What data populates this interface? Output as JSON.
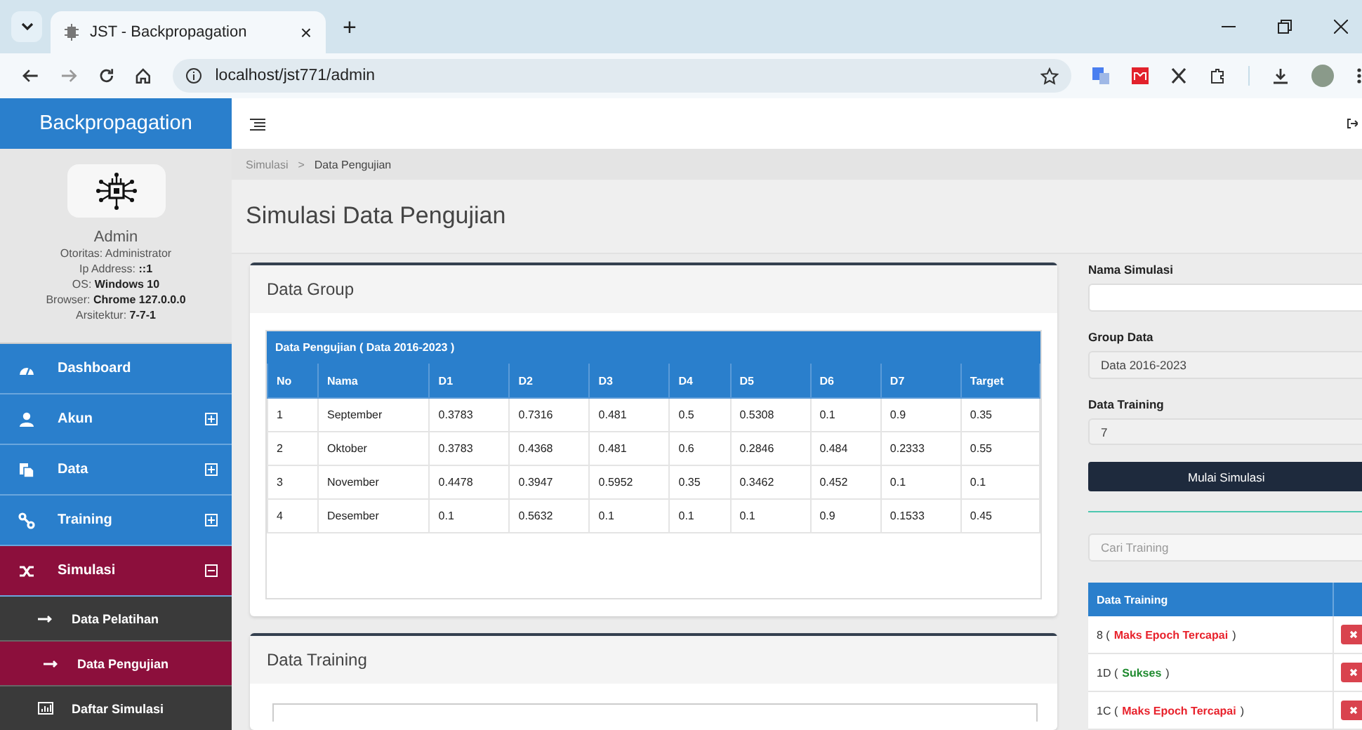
{
  "browser": {
    "tab_title": "JST - Backpropagation",
    "tab_close": "×",
    "new_tab": "+",
    "url": "localhost/jst771/admin"
  },
  "sidebar": {
    "brand": "Backpropagation",
    "profile": {
      "name": "Admin",
      "lines": [
        "Otoritas: Administrator",
        "Ip Address: **::1**",
        "OS: **Windows 10**",
        "Browser: **Chrome 127.0.0.0**",
        "Arsitektur: **7-7-1**"
      ]
    },
    "items": [
      {
        "label": "Dashboard"
      },
      {
        "label": "Akun",
        "expanded": false
      },
      {
        "label": "Data",
        "expanded": false
      },
      {
        "label": "Training",
        "expanded": false
      },
      {
        "label": "Simulasi",
        "expanded": true,
        "children": [
          {
            "label": "Data Pelatihan",
            "selected": false
          },
          {
            "label": "Data Pengujian",
            "selected": true
          },
          {
            "label": "Daftar Simulasi",
            "selected": false
          }
        ]
      }
    ]
  },
  "breadcrumb": [
    "Simulasi",
    "Data Pengujian"
  ],
  "breadcrumb_sep": ">",
  "page_title": "Simulasi Data Pengujian",
  "data_group": {
    "title": "Data Group",
    "table_caption": "Data Pengujian ( Data 2016-2023 )",
    "columns": [
      "No",
      "Nama",
      "D1",
      "D2",
      "D3",
      "D4",
      "D5",
      "D6",
      "D7",
      "Target"
    ],
    "rows": [
      [
        "1",
        "September",
        "0.3783",
        "0.7316",
        "0.481",
        "0.5",
        "0.5308",
        "0.1",
        "0.9",
        "0.35"
      ],
      [
        "2",
        "Oktober",
        "0.3783",
        "0.4368",
        "0.481",
        "0.6",
        "0.2846",
        "0.484",
        "0.2333",
        "0.55"
      ],
      [
        "3",
        "November",
        "0.4478",
        "0.3947",
        "0.5952",
        "0.35",
        "0.3462",
        "0.452",
        "0.1",
        "0.1"
      ],
      [
        "4",
        "Desember",
        "0.1",
        "0.5632",
        "0.1",
        "0.1",
        "0.1",
        "0.9",
        "0.1533",
        "0.45"
      ]
    ]
  },
  "data_training": {
    "title": "Data Training"
  },
  "form": {
    "fields": [
      {
        "label": "Nama Simulasi"
      },
      {
        "label": "Group Data",
        "value": "Data 2016-2023"
      },
      {
        "label": "Data Training",
        "value": "7"
      }
    ],
    "button": "Mulai Simulasi",
    "search_placeholder": "Cari Training",
    "training_header": "Data Training",
    "trainings": [
      {
        "prefix": "8 (",
        "status": "Maks Epoch Tercapai",
        "suffix": ")",
        "color": "#e8212b"
      },
      {
        "prefix": "1D (",
        "status": "Sukses",
        "suffix": ")",
        "color": "#1e8a2e"
      },
      {
        "prefix": "1C (",
        "status": "Maks Epoch Tercapai",
        "suffix": ")",
        "color": "#e8212b"
      }
    ]
  }
}
